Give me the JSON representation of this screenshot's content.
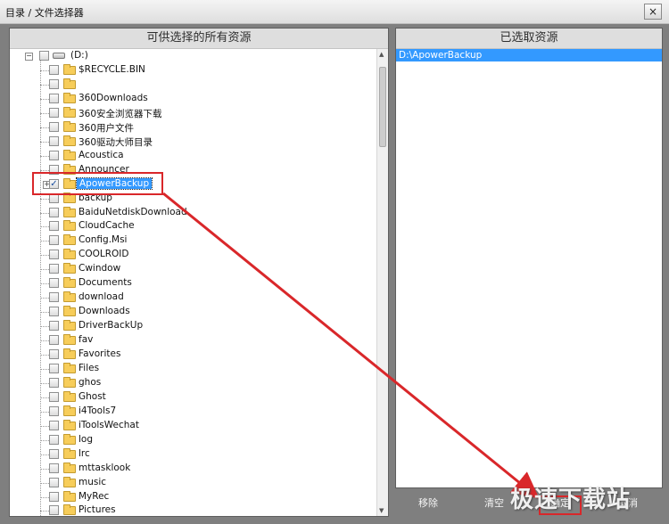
{
  "window": {
    "title": "目录 / 文件选择器",
    "close_label": "×"
  },
  "left_panel": {
    "header": "可供选择的所有资源",
    "root": {
      "label": "(D:)",
      "expand_symbol": "−"
    },
    "items": [
      {
        "label": "$RECYCLE.BIN",
        "checked": false
      },
      {
        "label": "",
        "checked": false
      },
      {
        "label": "360Downloads",
        "checked": false
      },
      {
        "label": "360安全浏览器下载",
        "checked": false
      },
      {
        "label": "360用户文件",
        "checked": false
      },
      {
        "label": "360驱动大师目录",
        "checked": false
      },
      {
        "label": "Acoustica",
        "checked": false
      },
      {
        "label": "Announcer",
        "checked": false
      },
      {
        "label": "ApowerBackup",
        "checked": true,
        "selected": true
      },
      {
        "label": "backup",
        "checked": false
      },
      {
        "label": "BaiduNetdiskDownload",
        "checked": false
      },
      {
        "label": "CloudCache",
        "checked": false
      },
      {
        "label": "Config.Msi",
        "checked": false
      },
      {
        "label": "COOLROID",
        "checked": false
      },
      {
        "label": "Cwindow",
        "checked": false
      },
      {
        "label": "Documents",
        "checked": false
      },
      {
        "label": "download",
        "checked": false
      },
      {
        "label": "Downloads",
        "checked": false
      },
      {
        "label": "DriverBackUp",
        "checked": false
      },
      {
        "label": "fav",
        "checked": false
      },
      {
        "label": "Favorites",
        "checked": false
      },
      {
        "label": "Files",
        "checked": false
      },
      {
        "label": "ghos",
        "checked": false
      },
      {
        "label": "Ghost",
        "checked": false
      },
      {
        "label": "i4Tools7",
        "checked": false
      },
      {
        "label": "iToolsWechat",
        "checked": false
      },
      {
        "label": "log",
        "checked": false
      },
      {
        "label": "lrc",
        "checked": false
      },
      {
        "label": "mttasklook",
        "checked": false
      },
      {
        "label": "music",
        "checked": false
      },
      {
        "label": "MyRec",
        "checked": false
      },
      {
        "label": "Pictures",
        "checked": false
      }
    ]
  },
  "right_panel": {
    "header": "已选取资源",
    "selected": [
      "D:\\ApowerBackup"
    ]
  },
  "buttons": {
    "remove": "移除",
    "clear": "清空",
    "confirm": "确定",
    "cancel": "取消"
  },
  "watermark": "极速下载站",
  "colors": {
    "selection": "#3399ff",
    "annotation": "#d9272a",
    "frame": "#7f7f7f"
  }
}
